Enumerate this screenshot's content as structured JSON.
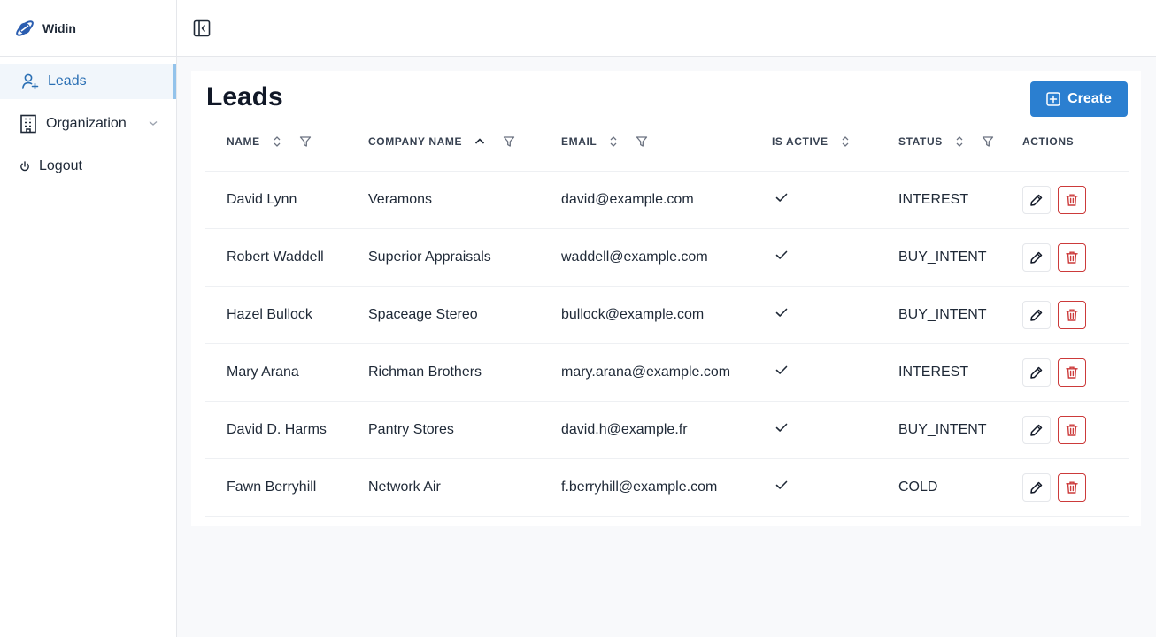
{
  "app": {
    "name": "Widin"
  },
  "sidebar": {
    "items": [
      {
        "label": "Leads",
        "icon": "user-plus-icon",
        "active": true
      },
      {
        "label": "Organization",
        "icon": "building-icon",
        "has_submenu": true
      },
      {
        "label": "Logout",
        "icon": "power-icon"
      }
    ]
  },
  "page": {
    "title": "Leads",
    "create_label": "Create"
  },
  "table": {
    "columns": {
      "name": "NAME",
      "company": "COMPANY NAME",
      "email": "EMAIL",
      "active": "IS ACTIVE",
      "status": "STATUS",
      "actions": "ACTIONS"
    },
    "rows": [
      {
        "name": "David Lynn",
        "company": "Veramons",
        "email": "david@example.com",
        "active": true,
        "status": "INTEREST"
      },
      {
        "name": "Robert Waddell",
        "company": "Superior Appraisals",
        "email": "waddell@example.com",
        "active": true,
        "status": "BUY_INTENT"
      },
      {
        "name": "Hazel Bullock",
        "company": "Spaceage Stereo",
        "email": "bullock@example.com",
        "active": true,
        "status": "BUY_INTENT"
      },
      {
        "name": "Mary Arana",
        "company": "Richman Brothers",
        "email": "mary.arana@example.com",
        "active": true,
        "status": "INTEREST"
      },
      {
        "name": "David D. Harms",
        "company": "Pantry Stores",
        "email": "david.h@example.fr",
        "active": true,
        "status": "BUY_INTENT"
      },
      {
        "name": "Fawn Berryhill",
        "company": "Network Air",
        "email": "f.berryhill@example.com",
        "active": true,
        "status": "COLD"
      }
    ]
  },
  "colors": {
    "primary": "#2b7fd0",
    "active_text": "#2a6fb4",
    "danger": "#cc3a3a"
  }
}
